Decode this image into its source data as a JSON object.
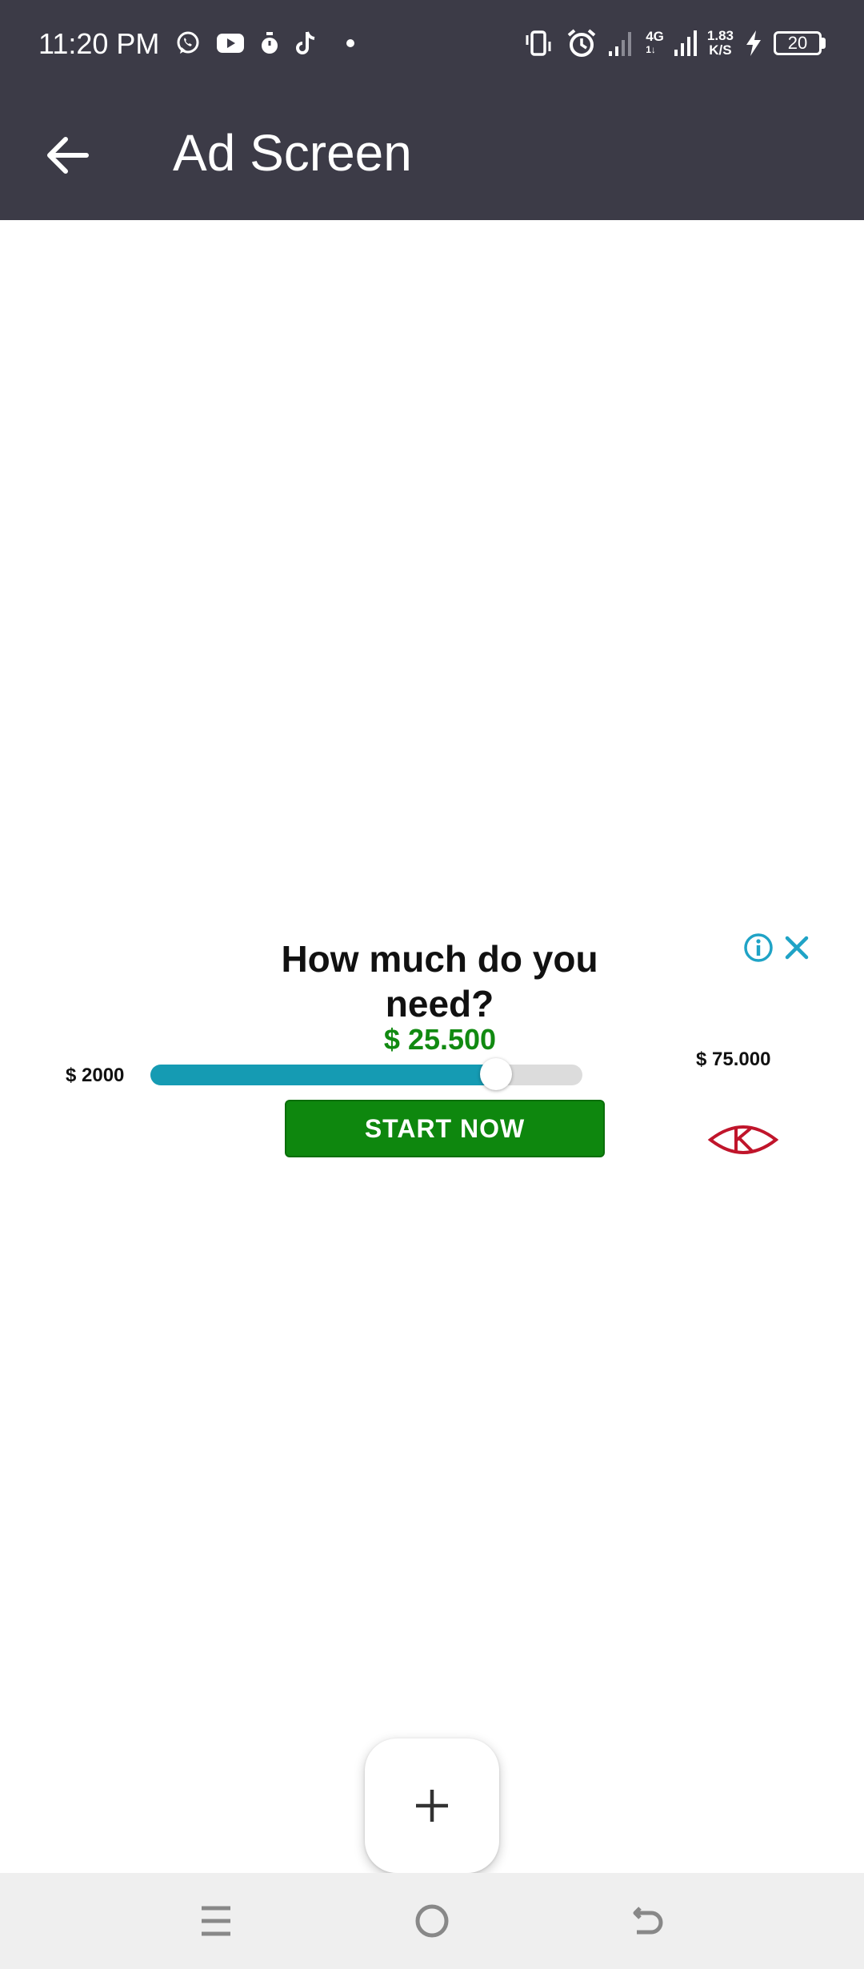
{
  "status_bar": {
    "time": "11:20 PM",
    "network_label": "4G",
    "network_sub": "1↓",
    "speed_value": "1.83",
    "speed_unit": "K/S",
    "battery": "20",
    "left_icons": [
      "whatsapp-icon",
      "youtube-icon",
      "timer-icon",
      "tiktok-icon",
      "dot-icon"
    ],
    "right_icons": [
      "vibrate-icon",
      "alarm-icon",
      "signal-icon",
      "signal-4g-icon",
      "charging-icon",
      "battery-icon"
    ]
  },
  "app_bar": {
    "title": "Ad Screen",
    "back_icon": "arrow-left-icon",
    "background": "#3c3b47"
  },
  "ad": {
    "headline_line1": "How much do you",
    "headline_line2": "need?",
    "amount": "$ 25.500",
    "min_label": "$ 2000",
    "max_label": "$ 75.000",
    "slider_fraction": 0.8,
    "button_label": "START NOW",
    "info_icon": "info-icon",
    "close_icon": "close-icon",
    "logo_icon": "eye-k-logo-icon",
    "colors": {
      "amount": "#118a11",
      "button": "#0e870e",
      "slider": "#159bb3",
      "adchoices": "#1fa3c6",
      "logo": "#c0152b"
    }
  },
  "fab": {
    "icon": "plus-icon"
  },
  "nav_bar": {
    "icons": [
      "menu-icon",
      "home-icon",
      "back-icon"
    ]
  }
}
